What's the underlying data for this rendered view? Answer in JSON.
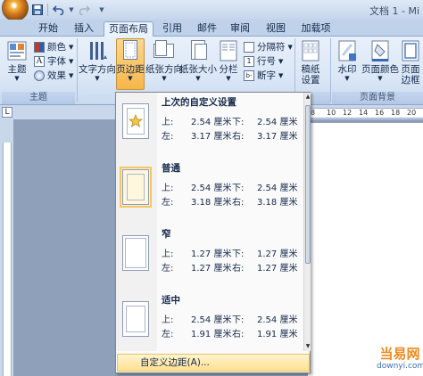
{
  "window": {
    "title": "文档 1 - Mi"
  },
  "quick_access": {
    "save": "save-icon",
    "undo": "undo-icon"
  },
  "tabs": [
    {
      "label": "开始"
    },
    {
      "label": "插入"
    },
    {
      "label": "页面布局"
    },
    {
      "label": "引用"
    },
    {
      "label": "邮件"
    },
    {
      "label": "审阅"
    },
    {
      "label": "视图"
    },
    {
      "label": "加载项"
    }
  ],
  "ribbon": {
    "theme": {
      "main": "主题",
      "colors": "颜色",
      "fonts": "字体",
      "effects": "效果",
      "group": "主题"
    },
    "page_setup": {
      "orientation": "文字方向",
      "margins": "页边距",
      "orientation2": "纸张方向",
      "size": "纸张大小",
      "columns": "分栏",
      "breaks": "分隔符",
      "line_numbers": "行号",
      "hyphenation": "断字"
    },
    "paper": {
      "line1": "稿纸",
      "line2": "设置"
    },
    "background": {
      "watermark": "水印",
      "page_color": "页面颜色",
      "page_border_1": "页面",
      "page_border_2": "边框",
      "group": "页面背景"
    }
  },
  "margins_menu": {
    "presets": [
      {
        "title": "上次的自定义设置",
        "top_label": "上:",
        "top": "2.54 厘米",
        "bottom_label": "下:",
        "bottom": "2.54 厘米",
        "left_label": "左:",
        "left": "3.17 厘米",
        "right_label": "右:",
        "right": "3.17 厘米"
      },
      {
        "title": "普通",
        "top_label": "上:",
        "top": "2.54 厘米",
        "bottom_label": "下:",
        "bottom": "2.54 厘米",
        "left_label": "左:",
        "left": "3.18 厘米",
        "right_label": "右:",
        "right": "3.18 厘米"
      },
      {
        "title": "窄",
        "top_label": "上:",
        "top": "1.27 厘米",
        "bottom_label": "下:",
        "bottom": "1.27 厘米",
        "left_label": "左:",
        "left": "1.27 厘米",
        "right_label": "右:",
        "right": "1.27 厘米"
      },
      {
        "title": "适中",
        "top_label": "上:",
        "top": "2.54 厘米",
        "bottom_label": "下:",
        "bottom": "2.54 厘米",
        "left_label": "左:",
        "left": "1.91 厘米",
        "right_label": "右:",
        "right": "1.91 厘米"
      }
    ],
    "custom": "自定义边距(A)..."
  },
  "ruler": {
    "marks": [
      "8",
      "10",
      "12",
      "14",
      "16",
      "18",
      "20"
    ],
    "corner": "L"
  },
  "watermark_logo": {
    "main": "当易网",
    "sub": "downyi.com"
  },
  "colors": {
    "accent_highlight": "#f7b64a",
    "ribbon_bg": "#dbe7f6",
    "menu_hover": "#ffe08f"
  }
}
